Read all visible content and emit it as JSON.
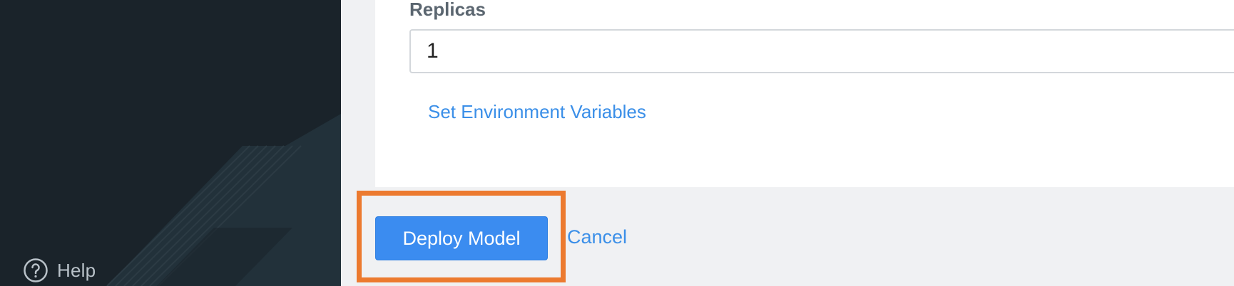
{
  "sidebar": {
    "help_label": "Help",
    "help_icon": "question-circle-icon"
  },
  "form": {
    "replicas_label": "Replicas",
    "replicas_value": "1",
    "env_link": "Set Environment Variables"
  },
  "actions": {
    "deploy_label": "Deploy Model",
    "cancel_label": "Cancel"
  },
  "colors": {
    "sidebar_bg": "#1a232a",
    "accent_blue": "#3b8cf0",
    "link_blue": "#3b8fe8",
    "highlight_orange": "#ec7a2f"
  }
}
